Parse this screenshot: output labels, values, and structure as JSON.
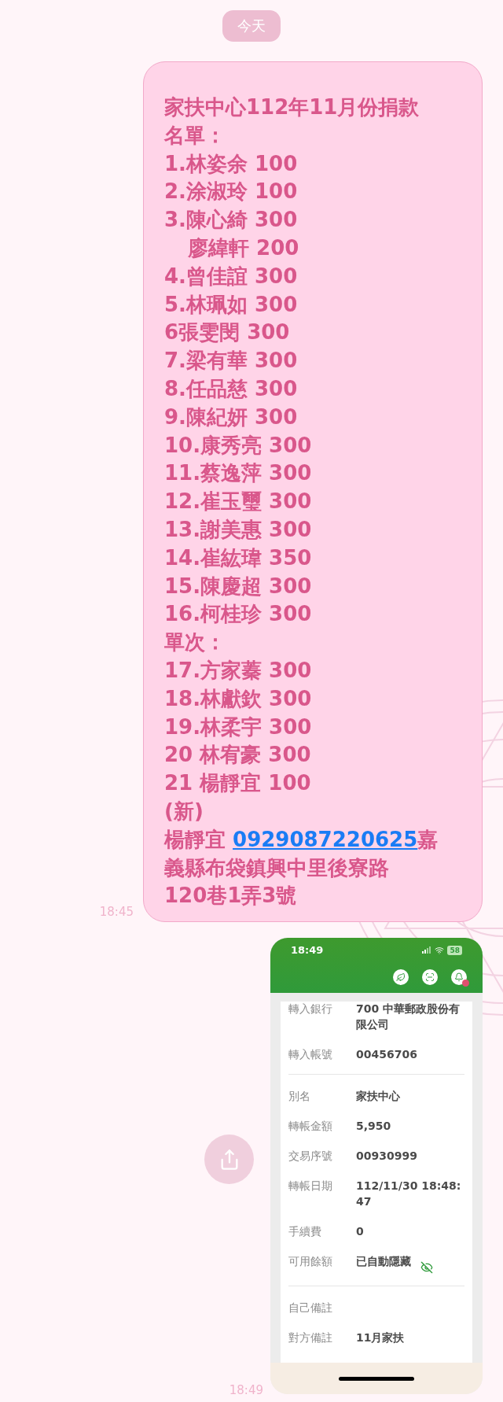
{
  "date_chip": "今天",
  "text_message": {
    "time": "18:45",
    "lines": [
      {
        "text": "家扶中心112年11月份捐款",
        "indent": false
      },
      {
        "text": "名單：",
        "indent": false
      },
      {
        "text": "1.林姿余 100",
        "indent": false
      },
      {
        "text": "2.涂淑玲 100",
        "indent": false
      },
      {
        "text": "3.陳心綺 300",
        "indent": false
      },
      {
        "text": "廖緯軒 200",
        "indent": true
      },
      {
        "text": "4.曾佳誼 300",
        "indent": false
      },
      {
        "text": "5.林珮如 300",
        "indent": false
      },
      {
        "text": "6張雯閔 300",
        "indent": false
      },
      {
        "text": "7.梁有華 300",
        "indent": false
      },
      {
        "text": "8.任品慈 300",
        "indent": false
      },
      {
        "text": "9.陳紀妍 300",
        "indent": false
      },
      {
        "text": "10.康秀亮 300",
        "indent": false
      },
      {
        "text": "11.蔡逸萍 300",
        "indent": false
      },
      {
        "text": "12.崔玉璽 300",
        "indent": false
      },
      {
        "text": "13.謝美惠 300",
        "indent": false
      },
      {
        "text": "14.崔紘瑋 350",
        "indent": false
      },
      {
        "text": "15.陳慶超 300",
        "indent": false
      },
      {
        "text": "16.柯桂珍 300",
        "indent": false
      },
      {
        "text": "單次：",
        "indent": false
      },
      {
        "text": "17.方家蓁 300",
        "indent": false
      },
      {
        "text": "18.林獻欽 300",
        "indent": false
      },
      {
        "text": "19.林柔宇 300",
        "indent": false
      },
      {
        "text": "20 林宥豪 300",
        "indent": false
      },
      {
        "text": "21 楊靜宜 100",
        "indent": false
      },
      {
        "text": "(新)",
        "indent": false
      }
    ],
    "contact": {
      "name": "楊靜宜",
      "phone": "0929087220625",
      "address_lines": [
        "嘉",
        "義縣布袋鎮興中里後寮路",
        "120巷1弄3號"
      ]
    }
  },
  "image_message": {
    "time": "18:49",
    "screenshot": {
      "status_time": "18:49",
      "battery": "58",
      "sections": [
        [
          {
            "label": "轉入銀行",
            "value": "700 中華郵政股份有限公司",
            "masked": false
          },
          {
            "label": "轉入帳號",
            "value": "00456706",
            "masked": false
          }
        ],
        [
          {
            "label": "別名",
            "value": "家扶中心",
            "masked": false
          },
          {
            "label": "轉帳金額",
            "value": "5,950",
            "masked": false
          },
          {
            "label": "交易序號",
            "value": "00930999",
            "masked": false
          },
          {
            "label": "轉帳日期",
            "value": "112/11/30 18:48:47",
            "masked": false
          },
          {
            "label": "手續費",
            "value": "0",
            "masked": false
          },
          {
            "label": "可用餘額",
            "value": "已自動隱藏",
            "masked": true
          }
        ],
        [
          {
            "label": "自己備註",
            "masked": false
          },
          {
            "label": "對方備註",
            "value": "11月家扶",
            "masked": false
          }
        ]
      ]
    }
  }
}
